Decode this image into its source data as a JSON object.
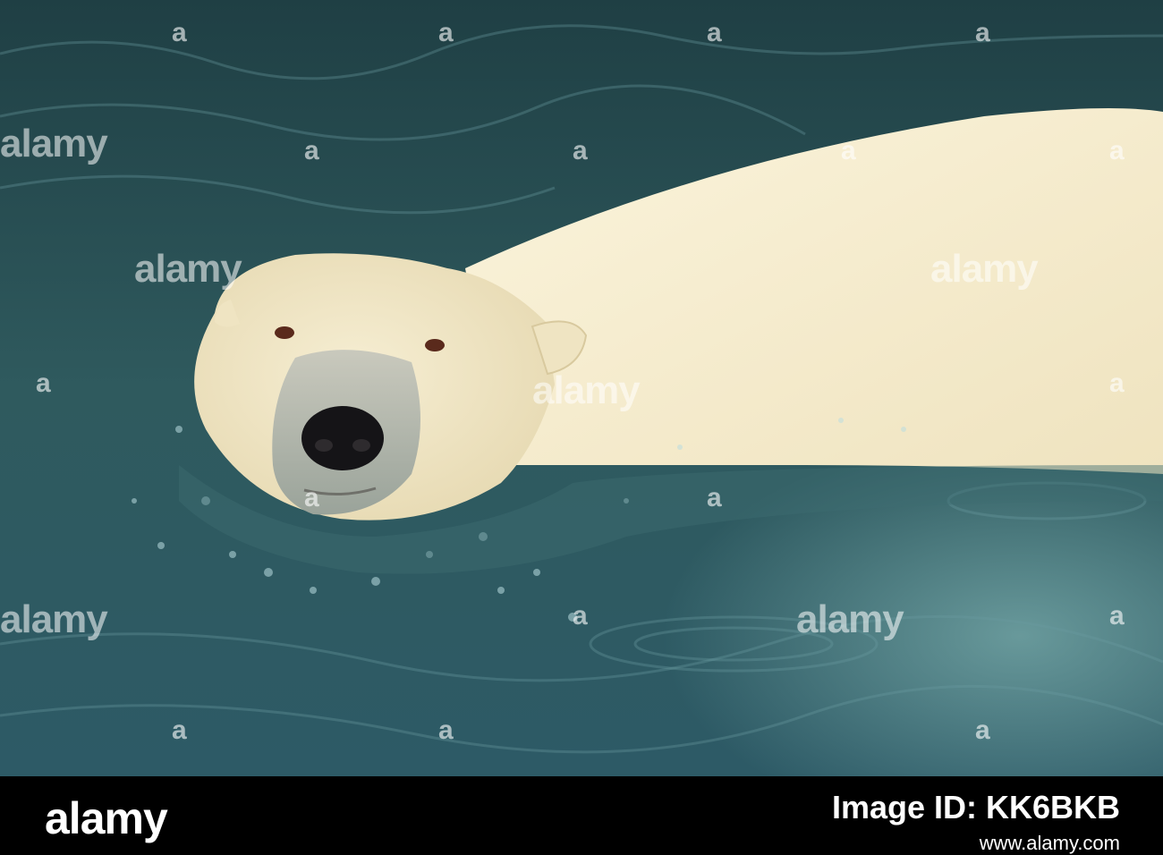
{
  "image": {
    "subject": "polar bear swimming",
    "water_color": "#2f5a5e",
    "fur_color": "#f3ead0"
  },
  "watermark": {
    "brand": "alamy",
    "short": "a"
  },
  "footer": {
    "logo": "alamy",
    "stock_label": "Image ID: KK6BKB",
    "url": "www.alamy.com"
  }
}
